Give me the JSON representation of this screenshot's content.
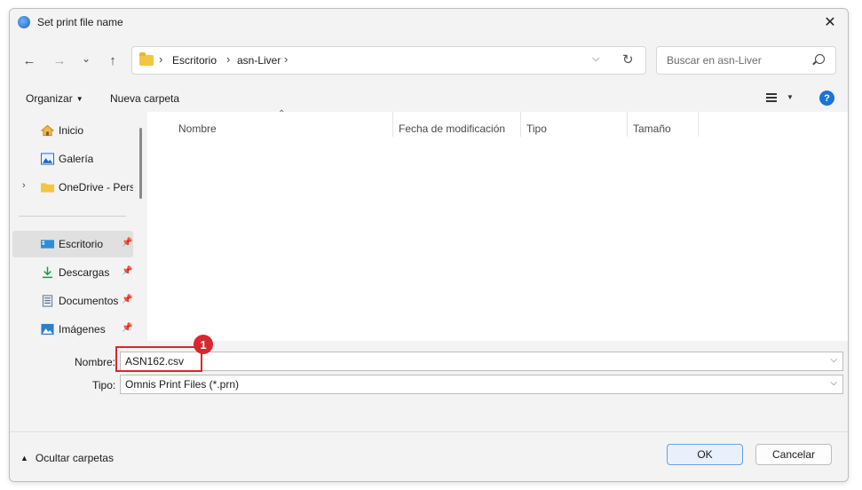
{
  "window": {
    "title": "Set print file name",
    "close_glyph": "✕"
  },
  "nav": {
    "back": "←",
    "forward": "→",
    "recent": "⌄",
    "up": "↑",
    "breadcrumbs": [
      "Escritorio",
      "asn-Liver"
    ],
    "search_placeholder": "Buscar en asn-Liver"
  },
  "toolbar": {
    "organize": "Organizar",
    "new_folder": "Nueva carpeta",
    "help": "?"
  },
  "sidebar": {
    "items": [
      {
        "label": "Inicio",
        "icon": "home-icon"
      },
      {
        "label": "Galería",
        "icon": "gallery-icon"
      },
      {
        "label": "OneDrive - Perso",
        "icon": "folder-icon"
      },
      {
        "label": "Escritorio",
        "icon": "desktop-icon",
        "pinned": true,
        "selected": true
      },
      {
        "label": "Descargas",
        "icon": "download-icon",
        "pinned": true
      },
      {
        "label": "Documentos",
        "icon": "document-icon",
        "pinned": true
      },
      {
        "label": "Imágenes",
        "icon": "pictures-icon",
        "pinned": true
      }
    ]
  },
  "columns": [
    "Nombre",
    "Fecha de modificación",
    "Tipo",
    "Tamaño"
  ],
  "form": {
    "filename_label": "Nombre:",
    "filename_value": "ASN162.csv",
    "type_label": "Tipo:",
    "type_value": "Omnis Print Files (*.prn)",
    "annotation_number": "1"
  },
  "footer": {
    "hide_folders": "Ocultar carpetas",
    "ok": "OK",
    "cancel": "Cancelar"
  },
  "colors": {
    "accent": "#1a73d8",
    "annotation": "#d9262f"
  }
}
